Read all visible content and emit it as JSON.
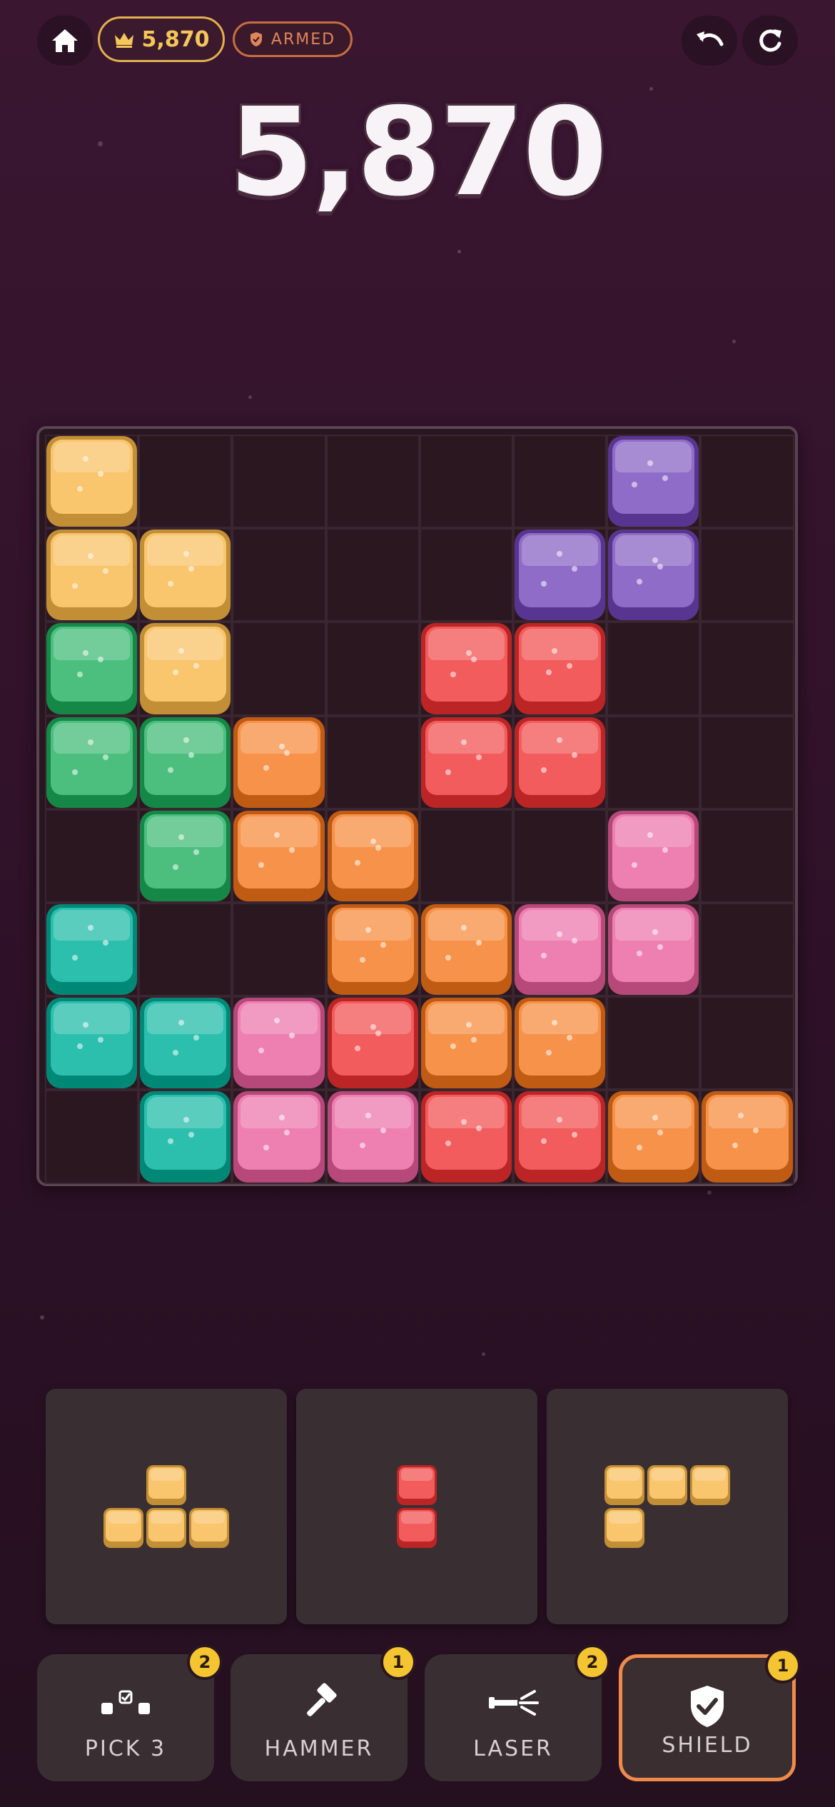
{
  "header": {
    "home_icon": "home-icon",
    "best_score": "5,870",
    "best_icon": "crown-icon",
    "shield_status": "ARMED",
    "undo_icon": "undo-icon",
    "restart_icon": "restart-icon"
  },
  "score": "5,870",
  "colors": {
    "yellow": "#f9c56d",
    "purple": "#8f6cc7",
    "green": "#4cbf7e",
    "red": "#f25c5c",
    "orange": "#f7924a",
    "pink": "#ee7fb1",
    "teal": "#2cbfae"
  },
  "board": {
    "rows": 8,
    "cols": 8,
    "grid": [
      [
        "yellow",
        null,
        null,
        null,
        null,
        null,
        "purple",
        null
      ],
      [
        "yellow",
        "yellow",
        null,
        null,
        null,
        "purple",
        "purple",
        null
      ],
      [
        "green",
        "yellow",
        null,
        null,
        "red",
        "red",
        null,
        null
      ],
      [
        "green",
        "green",
        "orange",
        null,
        "red",
        "red",
        null,
        null
      ],
      [
        null,
        "green",
        "orange",
        "orange",
        null,
        null,
        "pink",
        null
      ],
      [
        "teal",
        null,
        null,
        "orange",
        "orange",
        "pink",
        "pink",
        null
      ],
      [
        "teal",
        "teal",
        "pink",
        "red",
        "orange",
        "orange",
        null,
        null
      ],
      [
        null,
        "teal",
        "pink",
        "pink",
        "red",
        "red",
        "orange",
        "orange"
      ]
    ]
  },
  "pieces": [
    {
      "color": "yellow",
      "cells": [
        [
          0,
          1
        ],
        [
          1,
          0
        ],
        [
          1,
          1
        ],
        [
          1,
          2
        ]
      ]
    },
    {
      "color": "red",
      "cells": [
        [
          0,
          0
        ],
        [
          1,
          0
        ]
      ]
    },
    {
      "color": "yellow",
      "cells": [
        [
          0,
          0
        ],
        [
          0,
          1
        ],
        [
          0,
          2
        ],
        [
          1,
          0
        ]
      ]
    }
  ],
  "powerups": [
    {
      "label": "PICK 3",
      "count": "2",
      "icon": "pick-three-icon",
      "active": false
    },
    {
      "label": "HAMMER",
      "count": "1",
      "icon": "hammer-icon",
      "active": false
    },
    {
      "label": "LASER",
      "count": "2",
      "icon": "laser-icon",
      "active": false
    },
    {
      "label": "SHIELD",
      "count": "1",
      "icon": "shield-check-icon",
      "active": true
    }
  ]
}
